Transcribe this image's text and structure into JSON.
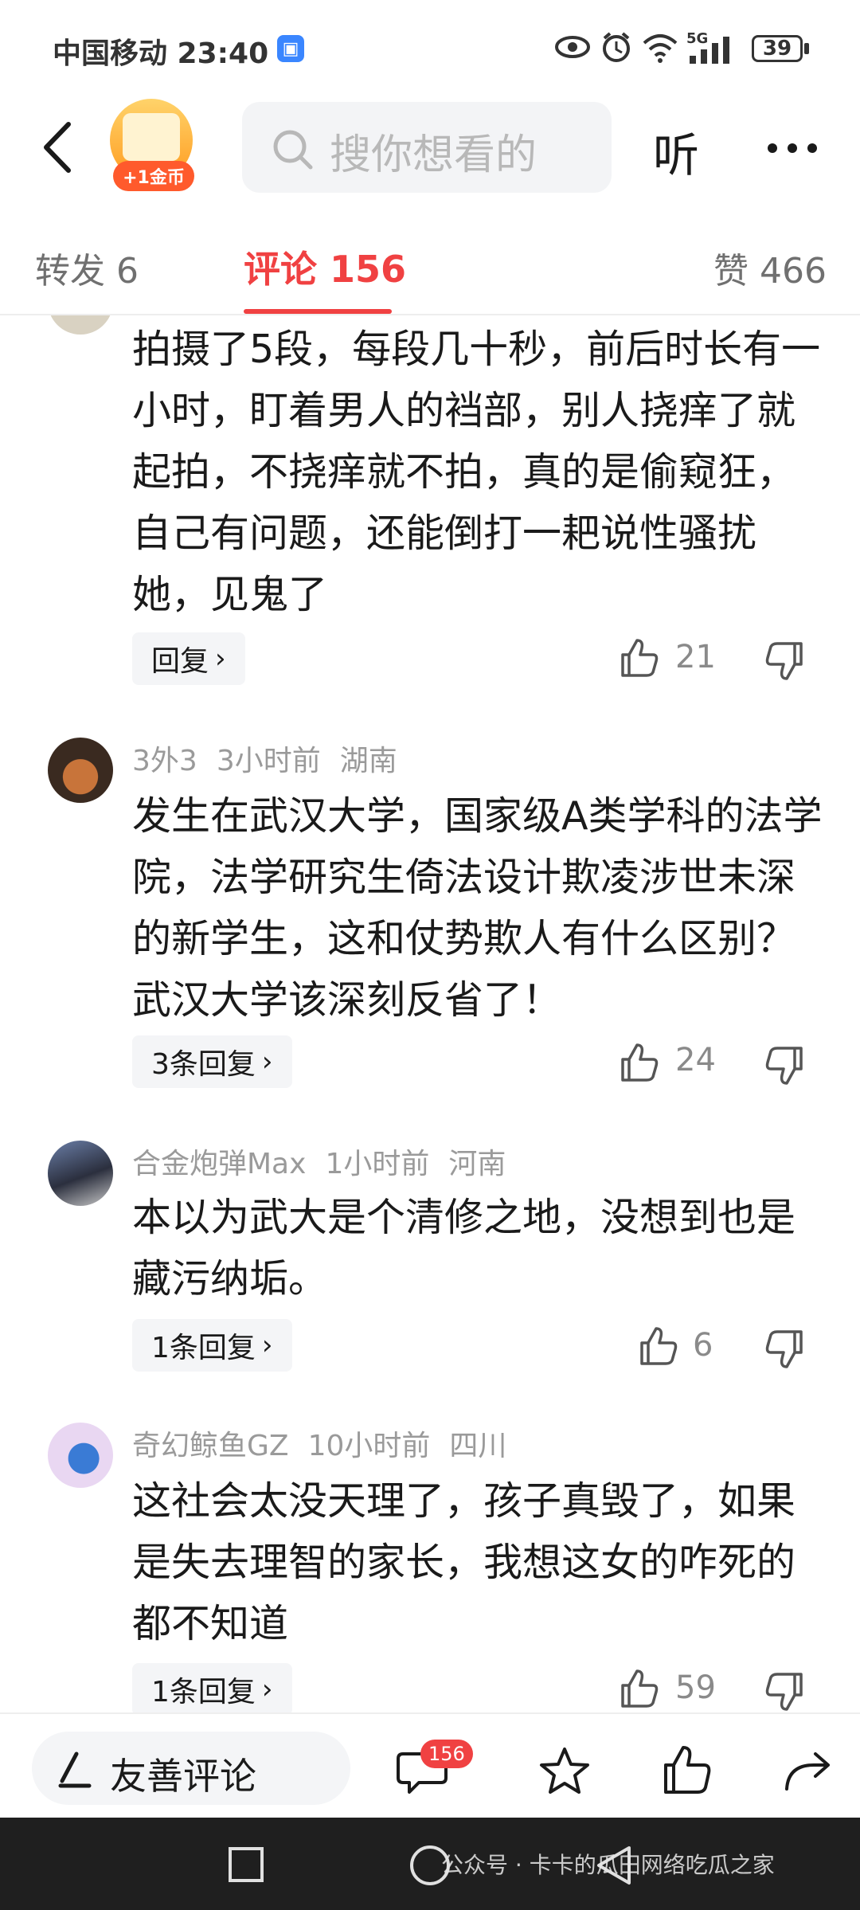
{
  "status_bar": {
    "carrier_time": "中国移动 23:40",
    "network": "5G",
    "battery": "39"
  },
  "top_bar": {
    "coin_pill": "+1金币",
    "search_placeholder": "搜你想看的",
    "listen_label": "听"
  },
  "tabs": {
    "forward": "转发 6",
    "comments": "评论 156",
    "likes": "赞 466"
  },
  "comments": [
    {
      "text": "拍摄了5段，每段几十秒，前后时长有一小时，盯着男人的裆部，别人挠痒了就起拍，不挠痒就不拍，真的是偷窥狂，自己有问题，还能倒打一耙说性骚扰她，见鬼了",
      "reply": "回复",
      "likes": "21"
    },
    {
      "user": "3外3",
      "time": "3小时前",
      "region": "湖南",
      "text": "发生在武汉大学，国家级A类学科的法学院，法学研究生倚法设计欺凌涉世未深的新学生，这和仗势欺人有什么区别？武汉大学该深刻反省了！",
      "reply": "3条回复",
      "likes": "24"
    },
    {
      "user": "合金炮弹Max",
      "time": "1小时前",
      "region": "河南",
      "text": "本以为武大是个清修之地，没想到也是藏污纳垢。",
      "reply": "1条回复",
      "likes": "6"
    },
    {
      "user": "奇幻鲸鱼GZ",
      "time": "10小时前",
      "region": "四川",
      "text": "这社会太没天理了，孩子真毁了，如果是失去理智的家长，我想这女的咋死的都不知道",
      "reply": "1条回复",
      "likes": "59"
    }
  ],
  "bottom_bar": {
    "input_label": "友善评论",
    "comment_badge": "156"
  },
  "watermark": "公众号 · 卡卡的瓜田网络吃瓜之家",
  "colors": {
    "accent": "#f04142",
    "meta_gray": "#9a9a9a",
    "nav_bg": "#1f1f1f"
  }
}
